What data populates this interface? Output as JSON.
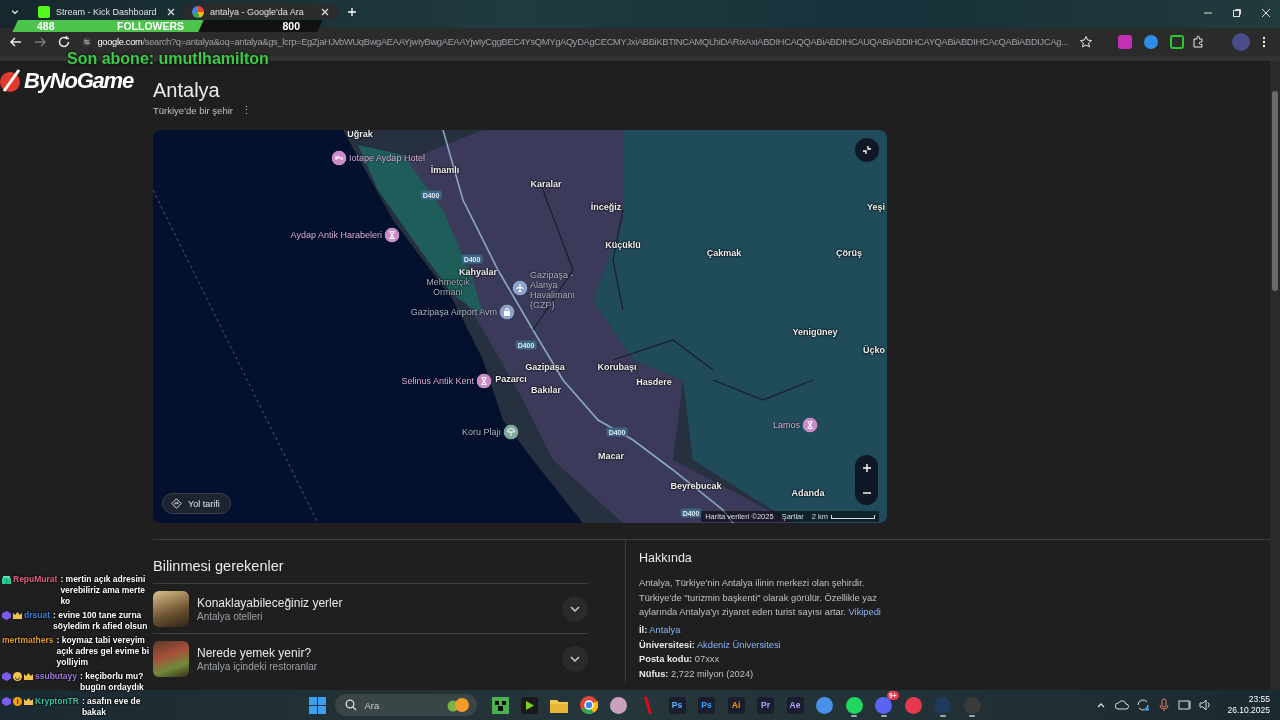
{
  "browser": {
    "tabs": [
      {
        "title": "Stream - Kick Dashboard",
        "kind": "kick",
        "selected": false
      },
      {
        "title": "antalya - Google'da Ara",
        "kind": "google",
        "selected": true
      }
    ],
    "url_host": "google.com",
    "url_path": "/search?q=antalya&oq=antalya&gs_lcrp=EgZjaHJvbWUqBwgAEAAYjwIyBwgAEAAYjwIyCggBEC4YsQMYgAQyDAgCECMYJxiABBiKBTINCAMQLhiDARixAxiABDIHCAQQABiABDIHCAUQABiABDIHCAYQABiABDIHCAcQABiABDIJCAg..."
  },
  "result": {
    "title": "Antalya",
    "subtitle": "Türkiye'de bir şehir",
    "more": "⋮"
  },
  "map": {
    "labels": [
      {
        "text": "Uğrak",
        "kind": "place"
      },
      {
        "text": "Iotape Aydap Hotel",
        "kind": "hotel",
        "color": "#c98cc6"
      },
      {
        "text": "İmamlı",
        "kind": "place"
      },
      {
        "text": "Karalar",
        "kind": "place"
      },
      {
        "text": "İnceğiz",
        "kind": "place"
      },
      {
        "text": "Yeşi",
        "kind": "place"
      },
      {
        "text": "Aydap Antik Harabeleri",
        "kind": "ruins",
        "color": "#c98cc6"
      },
      {
        "text": "Küçüklü",
        "kind": "place"
      },
      {
        "text": "Çakmak",
        "kind": "place"
      },
      {
        "text": "Çörüş",
        "kind": "place"
      },
      {
        "text": "Kahyalar",
        "kind": "place"
      },
      {
        "text": "Mehmetçik Ormanı",
        "kind": "area"
      },
      {
        "text": "Gazipaşa - Alanya Havalimanı (GZP)",
        "kind": "airport",
        "color": "#8ea3c9"
      },
      {
        "text": "Gazipaşa Airport Avm",
        "kind": "shop",
        "color": "#8ea3c9"
      },
      {
        "text": "Yenigüney",
        "kind": "place"
      },
      {
        "text": "Üçko",
        "kind": "place"
      },
      {
        "text": "Gazipaşa",
        "kind": "place"
      },
      {
        "text": "Korubaşı",
        "kind": "place"
      },
      {
        "text": "Selinus Antik Kent",
        "kind": "ruins",
        "color": "#c98cc6"
      },
      {
        "text": "Pazarcı",
        "kind": "place"
      },
      {
        "text": "Hasdere",
        "kind": "place"
      },
      {
        "text": "Bakılar",
        "kind": "place"
      },
      {
        "text": "Lamos",
        "kind": "ruins",
        "color": "#c98cc6"
      },
      {
        "text": "Koru Plajı",
        "kind": "beach",
        "color": "#7fa99a"
      },
      {
        "text": "Macar",
        "kind": "place"
      },
      {
        "text": "Beyrebucak",
        "kind": "place"
      },
      {
        "text": "Adanda",
        "kind": "place"
      }
    ],
    "road_shields": [
      "D400",
      "D400",
      "D400",
      "D400",
      "D400"
    ],
    "directions_button": "Yol tarifi",
    "attribution": "Harita verileri ©2025",
    "terms": "Şartlar",
    "scale": "2 km"
  },
  "things_to_know": {
    "heading": "Bilinmesi gerekenler",
    "items": [
      {
        "title": "Konaklayabileceğiniz yerler",
        "subtitle": "Antalya otelleri",
        "expanded": false
      },
      {
        "title": "Nerede yemek yenir?",
        "subtitle": "Antalya içindeki restoranlar",
        "expanded": false
      }
    ]
  },
  "about": {
    "heading": "Hakkında",
    "text": "Antalya, Türkiye'nin Antalya ilinin merkezi olan şehirdir. Türkiye'de \"turizmin başkenti\" olarak görülür. Özellikle yaz aylarında Antalya'yı ziyaret eden turist sayısı artar.",
    "source": "Vikipedi",
    "facts": [
      {
        "label": "İl:",
        "value": "Antalya",
        "link": true
      },
      {
        "label": "Üniversitesi:",
        "value": "Akdeniz Üniversitesi",
        "link": true
      },
      {
        "label": "Posta kodu:",
        "value": "07xxx",
        "link": false
      },
      {
        "label": "Nüfus:",
        "value": "2,722 milyon (2024)",
        "link": false
      }
    ]
  },
  "stream_overlay": {
    "logo": "ByNoGame",
    "followers": {
      "current": "488",
      "label": "FOLLOWERS",
      "goal": "800",
      "level": 0.61
    },
    "last_subscriber": "Son abone: umutlhamilton",
    "chat": [
      {
        "user": "RepuMurat",
        "color": "#e0607e",
        "text": ": mertin açık adresini verebiliriz ama merte ko"
      },
      {
        "user": "drsuat",
        "color": "#3d82d8",
        "text": ": evine 100 tane zurna söyledim rk afied olsun"
      },
      {
        "user": "mertmathers",
        "color": "#e09a2c",
        "text": ": koymaz tabi vereyim açık adres gel evime bi yolliyim"
      },
      {
        "user": "ssubutayy",
        "color": "#a27be0",
        "text": ": keçiborlu mu? bugün ordaydık"
      },
      {
        "user": "KryptonTR",
        "color": "#35c4a0",
        "text": ": asafın eve de bakak"
      }
    ]
  },
  "taskbar": {
    "search_placeholder": "Ara",
    "apps": [
      {
        "kind": "blocks",
        "color": "#4caf50",
        "running": false
      },
      {
        "kind": "play",
        "color": "#1a1a1a",
        "running": false
      },
      {
        "kind": "folder",
        "color": "#f2c94c",
        "running": false
      },
      {
        "kind": "browser",
        "color": "#e0463a",
        "running": false
      },
      {
        "kind": "orb",
        "color": "#c9a0c0",
        "running": false
      },
      {
        "kind": "bar",
        "color": "#e50914",
        "running": false
      },
      {
        "kind": "tile",
        "color": "#5fb6ff",
        "label": "Ps",
        "running": false
      },
      {
        "kind": "tile",
        "color": "#31a8ff",
        "label": "Ps",
        "running": false
      },
      {
        "kind": "tile",
        "color": "#ff9a00",
        "label": "Ai",
        "running": false
      },
      {
        "kind": "tile",
        "color": "#b4a0ff",
        "label": "Pr",
        "running": false
      },
      {
        "kind": "tile",
        "color": "#b4a0ff",
        "label": "Ae",
        "running": false
      },
      {
        "kind": "orb",
        "color": "#4a8fe8",
        "running": false
      },
      {
        "kind": "orb",
        "color": "#1ed760",
        "running": true
      },
      {
        "kind": "orb",
        "color": "#5865f2",
        "running": true,
        "badge": "9+"
      },
      {
        "kind": "orb",
        "color": "#e53950",
        "running": false
      },
      {
        "kind": "orb",
        "color": "#1d3a5c",
        "running": true
      },
      {
        "kind": "orb",
        "color": "#3a3a3a",
        "running": true
      }
    ],
    "time": "23:55",
    "date": "26.10.2025"
  }
}
